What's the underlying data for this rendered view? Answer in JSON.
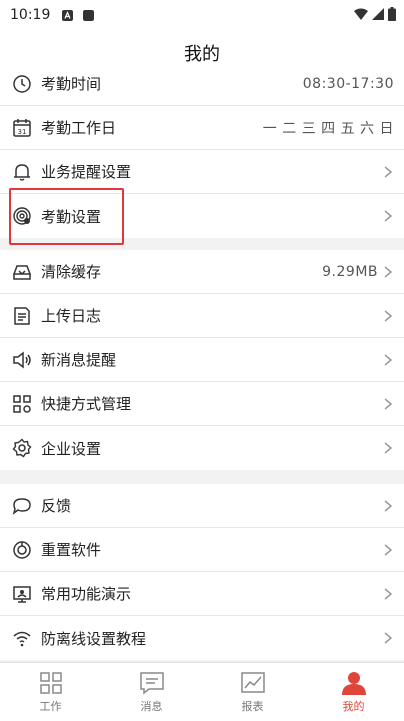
{
  "status": {
    "time": "10:19"
  },
  "title": "我的",
  "section1": [
    {
      "label": "考勤时间",
      "value": "08:30-17:30",
      "icon": "clock-icon"
    },
    {
      "label": "考勤工作日",
      "value": "一 二 三 四 五 六 日",
      "icon": "calendar-icon",
      "calendar_day": "31"
    },
    {
      "label": "业务提醒设置",
      "icon": "bell-icon"
    },
    {
      "label": "考勤设置",
      "icon": "fingerprint-icon"
    }
  ],
  "section2": [
    {
      "label": "清除缓存",
      "value": "9.29MB",
      "icon": "cache-icon"
    },
    {
      "label": "上传日志",
      "icon": "log-icon"
    },
    {
      "label": "新消息提醒",
      "icon": "speaker-icon"
    },
    {
      "label": "快捷方式管理",
      "icon": "shortcut-icon"
    },
    {
      "label": "企业设置",
      "icon": "gear-icon"
    }
  ],
  "section3": [
    {
      "label": "反馈",
      "icon": "feedback-icon"
    },
    {
      "label": "重置软件",
      "icon": "reset-icon"
    },
    {
      "label": "常用功能演示",
      "icon": "demo-icon"
    },
    {
      "label": "防离线设置教程",
      "icon": "wifi-icon"
    }
  ],
  "tabs": [
    {
      "label": "工作",
      "icon": "grid-icon"
    },
    {
      "label": "消息",
      "icon": "message-icon"
    },
    {
      "label": "报表",
      "icon": "chart-icon"
    },
    {
      "label": "我的",
      "icon": "person-icon",
      "active": true
    }
  ],
  "colors": {
    "accent": "#e0453a",
    "highlight": "#e0363d"
  }
}
